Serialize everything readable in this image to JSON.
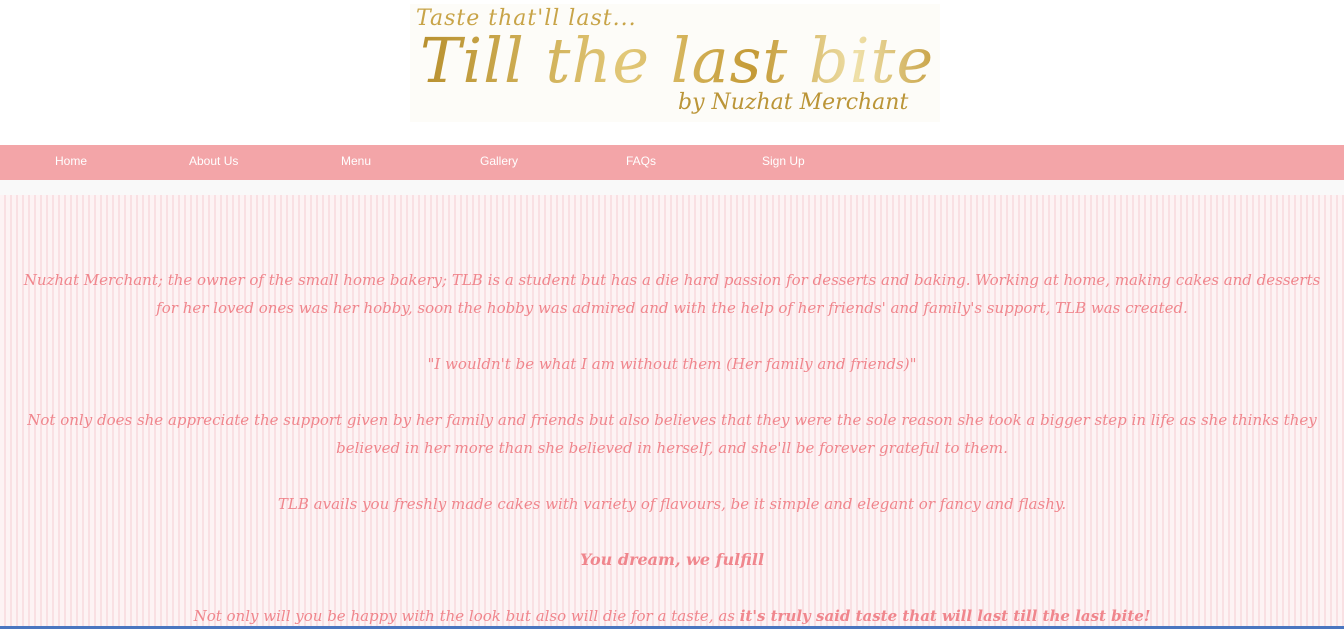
{
  "logo": {
    "tagline": "Taste that'll last...",
    "title": "Till the last bite",
    "byline": "by Nuzhat Merchant"
  },
  "nav": {
    "items": [
      "Home",
      "About Us",
      "Menu",
      "Gallery",
      "FAQs",
      "Sign Up"
    ]
  },
  "content": {
    "p1": "Nuzhat Merchant; the owner of the small home bakery; TLB is a student but has a die hard passion for desserts and baking. Working at home, making cakes and desserts for her loved ones was her hobby, soon the hobby was admired and with the help of her friends' and family's support, TLB was created.",
    "quote": "\"I wouldn't be what I am without them (Her family and friends)\"",
    "p2": "Not only does she appreciate the support given by her family and friends but also believes that they were the sole reason she took a bigger step in life as she thinks they believed in her more than she believed in herself, and she'll be forever grateful to them.",
    "p3": "TLB avails you freshly made cakes with variety of flavours, be it simple and elegant or fancy and flashy.",
    "slogan": "You dream, we fulfill",
    "p4_start": "Not only will you be happy with the look but also will die for a taste, as ",
    "p4_bold": "it's truly said taste that will last till the last bite!"
  },
  "colors": {
    "nav_bg": "#f3a5a8",
    "text_pink": "#f0868d",
    "gold": "#c9a449"
  }
}
